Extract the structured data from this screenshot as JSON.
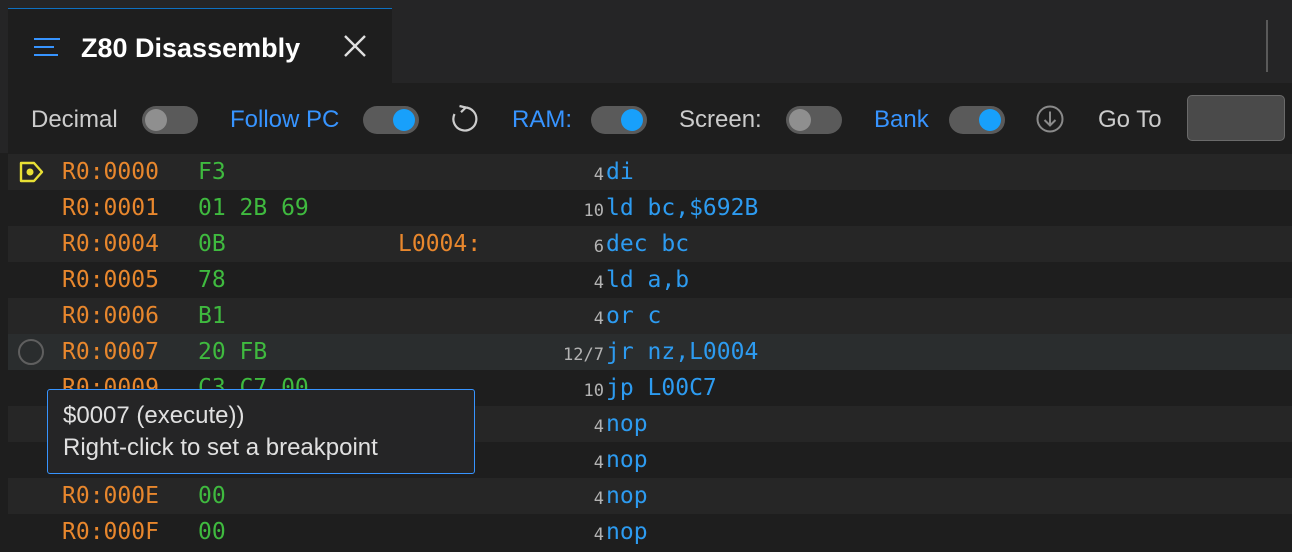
{
  "tab": {
    "title": "Z80 Disassembly",
    "icon": "lines-icon",
    "close_icon": "close-icon"
  },
  "toolbar": {
    "decimal_label": "Decimal",
    "decimal_on": false,
    "follow_pc_label": "Follow PC",
    "follow_pc_on": true,
    "refresh_icon": "refresh-icon",
    "ram_label": "RAM:",
    "ram_on": true,
    "screen_label": "Screen:",
    "screen_on": false,
    "bank_label": "Bank",
    "bank_on": true,
    "download_icon": "arrow-down-circle-icon",
    "goto_label": "Go To",
    "goto_value": ""
  },
  "rows": [
    {
      "addr": "R0:0000",
      "bytes": "F3",
      "label": "",
      "cycles": "4",
      "instr": "di",
      "marker": "pc"
    },
    {
      "addr": "R0:0001",
      "bytes": "01 2B 69",
      "label": "",
      "cycles": "10",
      "instr": "ld bc,$692B",
      "marker": ""
    },
    {
      "addr": "R0:0004",
      "bytes": "0B",
      "label": "L0004:",
      "cycles": "6",
      "instr": "dec bc",
      "marker": ""
    },
    {
      "addr": "R0:0005",
      "bytes": "78",
      "label": "",
      "cycles": "4",
      "instr": "ld a,b",
      "marker": ""
    },
    {
      "addr": "R0:0006",
      "bytes": "B1",
      "label": "",
      "cycles": "4",
      "instr": "or c",
      "marker": ""
    },
    {
      "addr": "R0:0007",
      "bytes": "20 FB",
      "label": "",
      "cycles": "12/7",
      "instr": "jr nz,L0004",
      "marker": "bp-hover"
    },
    {
      "addr": "R0:0009",
      "bytes": "C3 C7 00",
      "label": "",
      "cycles": "10",
      "instr": "jp L00C7",
      "marker": ""
    },
    {
      "addr": "",
      "bytes": "",
      "label": "",
      "cycles": "4",
      "instr": "nop",
      "marker": ""
    },
    {
      "addr": "",
      "bytes": "",
      "label": "",
      "cycles": "4",
      "instr": "nop",
      "marker": ""
    },
    {
      "addr": "R0:000E",
      "bytes": "00",
      "label": "",
      "cycles": "4",
      "instr": "nop",
      "marker": ""
    },
    {
      "addr": "R0:000F",
      "bytes": "00",
      "label": "",
      "cycles": "4",
      "instr": "nop",
      "marker": ""
    }
  ],
  "tooltip": {
    "line1": "$0007 (execute))",
    "line2": "Right-click to set a breakpoint"
  },
  "colors": {
    "address": "#e8872d",
    "bytes": "#3fba3f",
    "instruction": "#2d9bf0",
    "accent": "#3794ff",
    "pc_marker": "#e8e035"
  }
}
